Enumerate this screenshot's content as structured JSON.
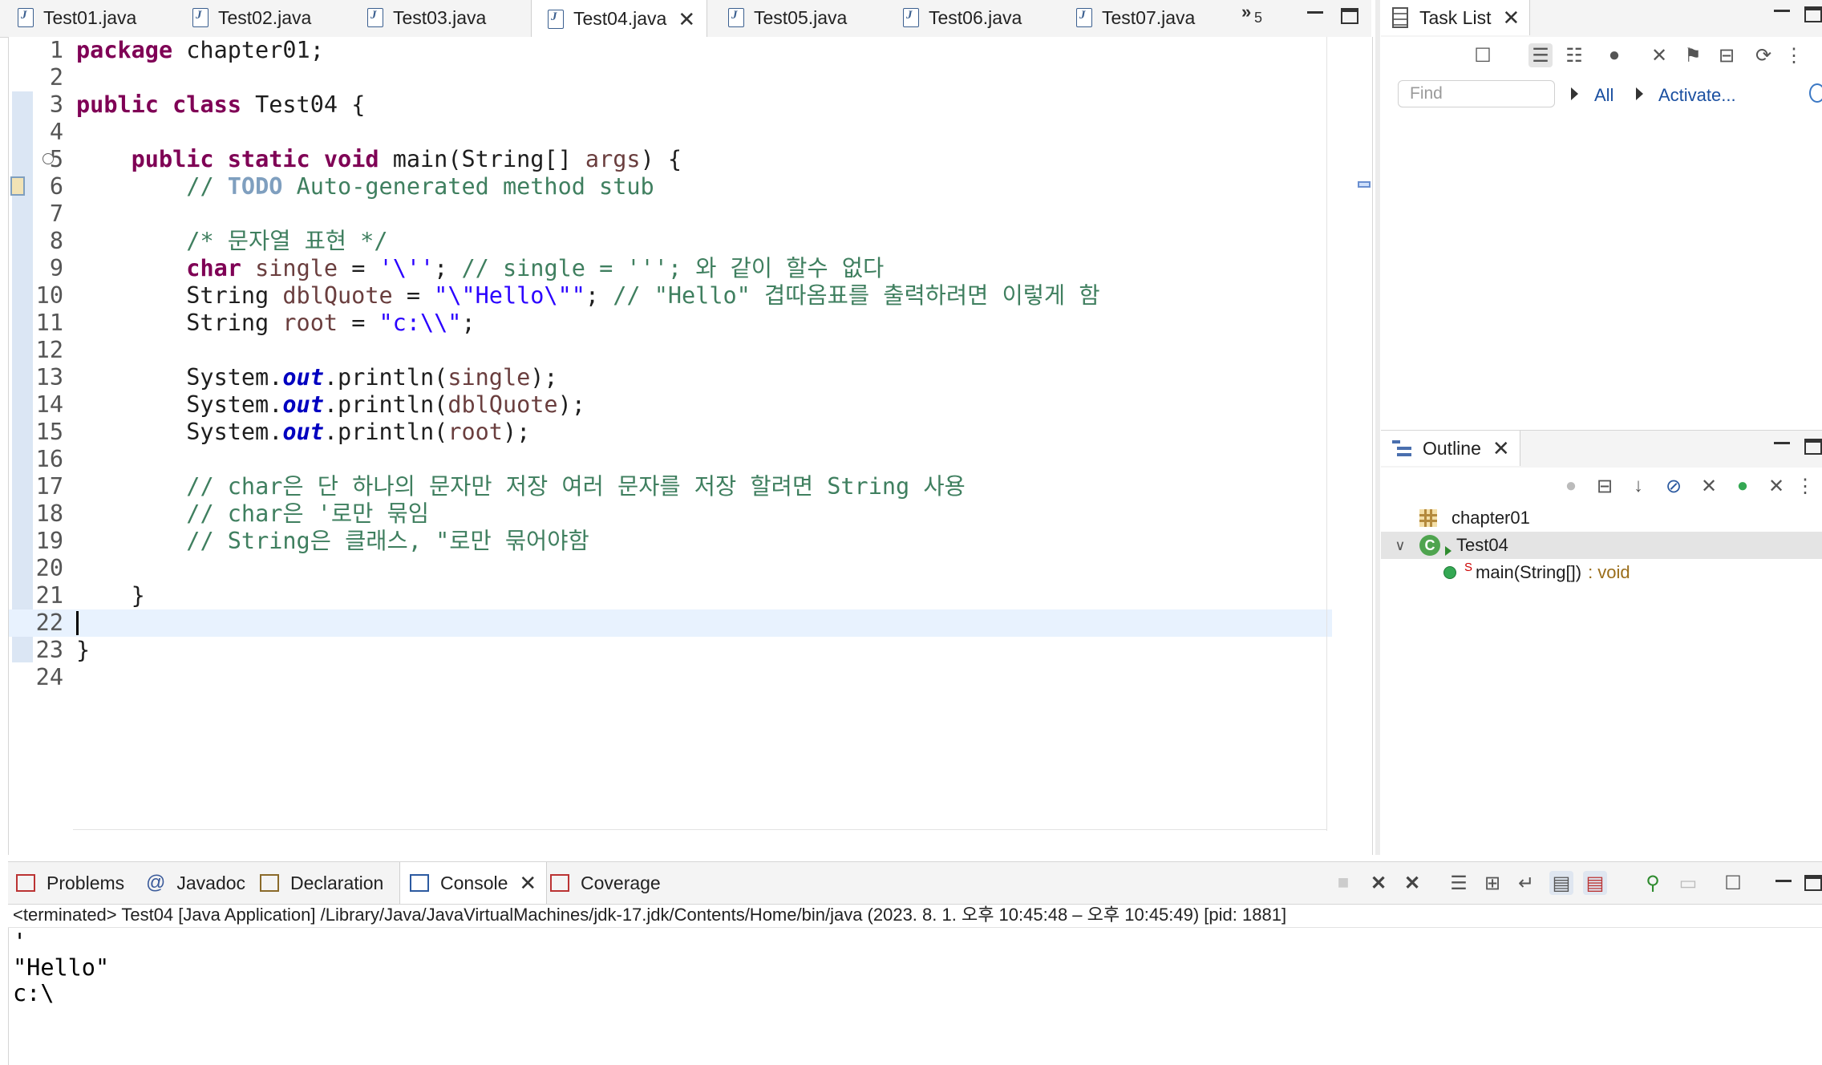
{
  "editor_tabs": [
    {
      "label": "Test01.java",
      "active": false
    },
    {
      "label": "Test02.java",
      "active": false
    },
    {
      "label": "Test03.java",
      "active": false
    },
    {
      "label": "Test04.java",
      "active": true
    },
    {
      "label": "Test05.java",
      "active": false
    },
    {
      "label": "Test06.java",
      "active": false
    },
    {
      "label": "Test07.java",
      "active": false
    }
  ],
  "overflow_chevron": "»",
  "overflow_count": "5",
  "close_glyph": "✕",
  "editor": {
    "current_line": 22,
    "lines": [
      {
        "n": "1",
        "html": "<span class='kw'>package</span> chapter01;"
      },
      {
        "n": "2",
        "html": ""
      },
      {
        "n": "3",
        "html": "<span class='kw'>public</span> <span class='kw'>class</span> Test04 {"
      },
      {
        "n": "4",
        "html": ""
      },
      {
        "n": "5",
        "html": "    <span class='kw'>public</span> <span class='kw'>static</span> <span class='kw'>void</span> main(String[] <span class='var'>args</span>) {"
      },
      {
        "n": "6",
        "html": "        <span class='cmt'>// </span><span class='todo'>TODO</span><span class='cmt'> Auto-generated method stub</span>"
      },
      {
        "n": "7",
        "html": ""
      },
      {
        "n": "8",
        "html": "        <span class='cmt'>/* 문자열 표현 */</span>"
      },
      {
        "n": "9",
        "html": "        <span class='kw'>char</span> <span class='var'>single</span> = <span class='str'>'\\''</span>; <span class='cmt'>// single = '''; 와 같이 할수 없다</span>"
      },
      {
        "n": "10",
        "html": "        String <span class='var'>dblQuote</span> = <span class='str'>\"\\\"Hello\\\"\"</span>; <span class='cmt'>// \"Hello\" 겹따옴표를 출력하려면 이렇게 함</span>"
      },
      {
        "n": "11",
        "html": "        String <span class='var'>root</span> = <span class='str'>\"c:\\\\\"</span>;"
      },
      {
        "n": "12",
        "html": ""
      },
      {
        "n": "13",
        "html": "        System.<span class='fld'>out</span>.println(<span class='var'>single</span>);"
      },
      {
        "n": "14",
        "html": "        System.<span class='fld'>out</span>.println(<span class='var'>dblQuote</span>);"
      },
      {
        "n": "15",
        "html": "        System.<span class='fld'>out</span>.println(<span class='var'>root</span>);"
      },
      {
        "n": "16",
        "html": ""
      },
      {
        "n": "17",
        "html": "        <span class='cmt'>// char은 단 하나의 문자만 저장 여러 문자를 저장 할려면 String 사용</span>"
      },
      {
        "n": "18",
        "html": "        <span class='cmt'>// char은 '로만 묶임</span>"
      },
      {
        "n": "19",
        "html": "        <span class='cmt'>// String은 클래스, \"로만 묶어야함</span>"
      },
      {
        "n": "20",
        "html": ""
      },
      {
        "n": "21",
        "html": "    }"
      },
      {
        "n": "22",
        "html": ""
      },
      {
        "n": "23",
        "html": "}"
      },
      {
        "n": "24",
        "html": ""
      }
    ]
  },
  "task_list": {
    "title": "Task List",
    "find_placeholder": "Find",
    "all_label": "All",
    "activate_label": "Activate..."
  },
  "outline": {
    "title": "Outline",
    "items": [
      {
        "label": "chapter01"
      },
      {
        "label": "Test04"
      },
      {
        "label": "main(String[])",
        "type_suffix": ": void",
        "modifier": "S"
      }
    ]
  },
  "bottom_tabs": [
    {
      "label": "Problems",
      "active": false
    },
    {
      "label": "Javadoc",
      "active": false
    },
    {
      "label": "Declaration",
      "active": false
    },
    {
      "label": "Console",
      "active": true
    },
    {
      "label": "Coverage",
      "active": false
    }
  ],
  "console": {
    "status": "<terminated> Test04 [Java Application] /Library/Java/JavaVirtualMachines/jdk-17.jdk/Contents/Home/bin/java  (2023. 8. 1. 오후 10:45:48 – 오후 10:45:49) [pid: 1881]",
    "output": [
      "'",
      "\"Hello\"",
      "c:\\"
    ]
  },
  "colors": {
    "keyword": "#7f0055",
    "string": "#2a00ff",
    "comment": "#3f7f5f",
    "todo": "#7f9fbf",
    "field": "#0000c0",
    "current_line": "#e8f2fe"
  }
}
